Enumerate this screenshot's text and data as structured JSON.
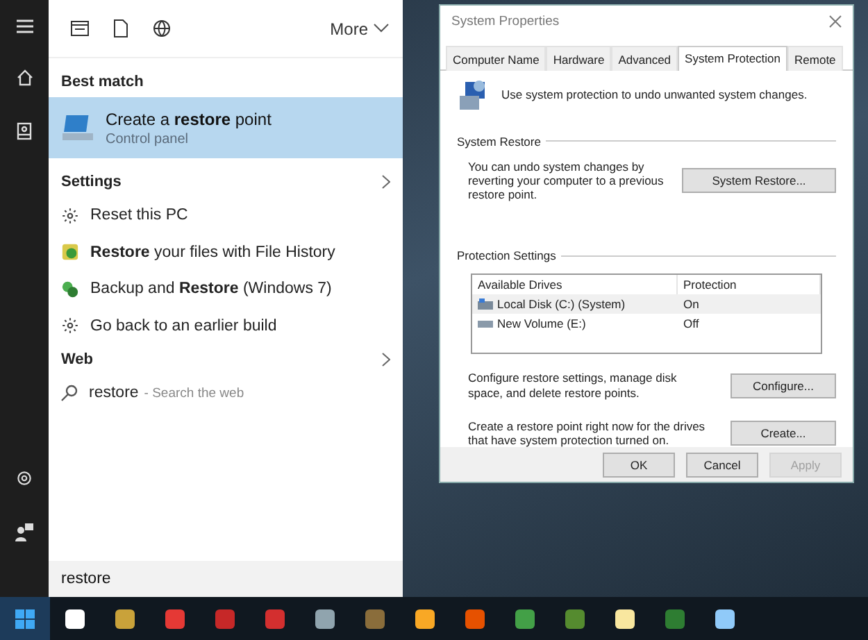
{
  "start_panel": {
    "toolbar": {
      "more": "More"
    },
    "best_match": {
      "heading": "Best match",
      "item": {
        "title": "Create a **restore** point",
        "subtitle": "Control panel",
        "selected": true
      }
    },
    "settings": {
      "heading": "Settings",
      "items": [
        {
          "kind": "gear",
          "label": "Reset this PC"
        },
        {
          "kind": "history",
          "label": "**Restore** your files with File History"
        },
        {
          "kind": "backup",
          "label": "Backup and **Restore** (Windows 7)"
        },
        {
          "kind": "gear",
          "label": "Go back to an earlier build"
        }
      ]
    },
    "web": {
      "heading": "Web",
      "query": "restore",
      "hint": "- Search the web"
    },
    "search": {
      "value": "restore"
    }
  },
  "dialog": {
    "title": "System Properties",
    "tabs": [
      {
        "label": "Computer Name",
        "selected": false
      },
      {
        "label": "Hardware",
        "selected": false
      },
      {
        "label": "Advanced",
        "selected": false
      },
      {
        "label": "System Protection",
        "selected": true
      },
      {
        "label": "Remote",
        "selected": false
      }
    ],
    "intro": "Use system protection to undo unwanted system changes.",
    "system_restore": {
      "heading": "System Restore",
      "text": "You can undo system changes by reverting your computer to a previous restore point.",
      "button": "System Restore..."
    },
    "protection": {
      "heading": "Protection Settings",
      "columns": [
        "Available Drives",
        "Protection"
      ],
      "rows": [
        {
          "kind": "system",
          "drive": "Local Disk (C:) (System)",
          "protection": "On",
          "selected": true
        },
        {
          "kind": "volume",
          "drive": "New Volume (E:)",
          "protection": "Off",
          "selected": false
        }
      ],
      "configure_text": "Configure restore settings, manage disk space, and delete restore points.",
      "configure_button": "Configure...",
      "create_text": "Create a restore point right now for the drives that have system protection turned on.",
      "create_button": "Create..."
    },
    "buttons": [
      {
        "label": "OK",
        "disabled": false
      },
      {
        "label": "Cancel",
        "disabled": false
      },
      {
        "label": "Apply",
        "disabled": true
      }
    ]
  }
}
